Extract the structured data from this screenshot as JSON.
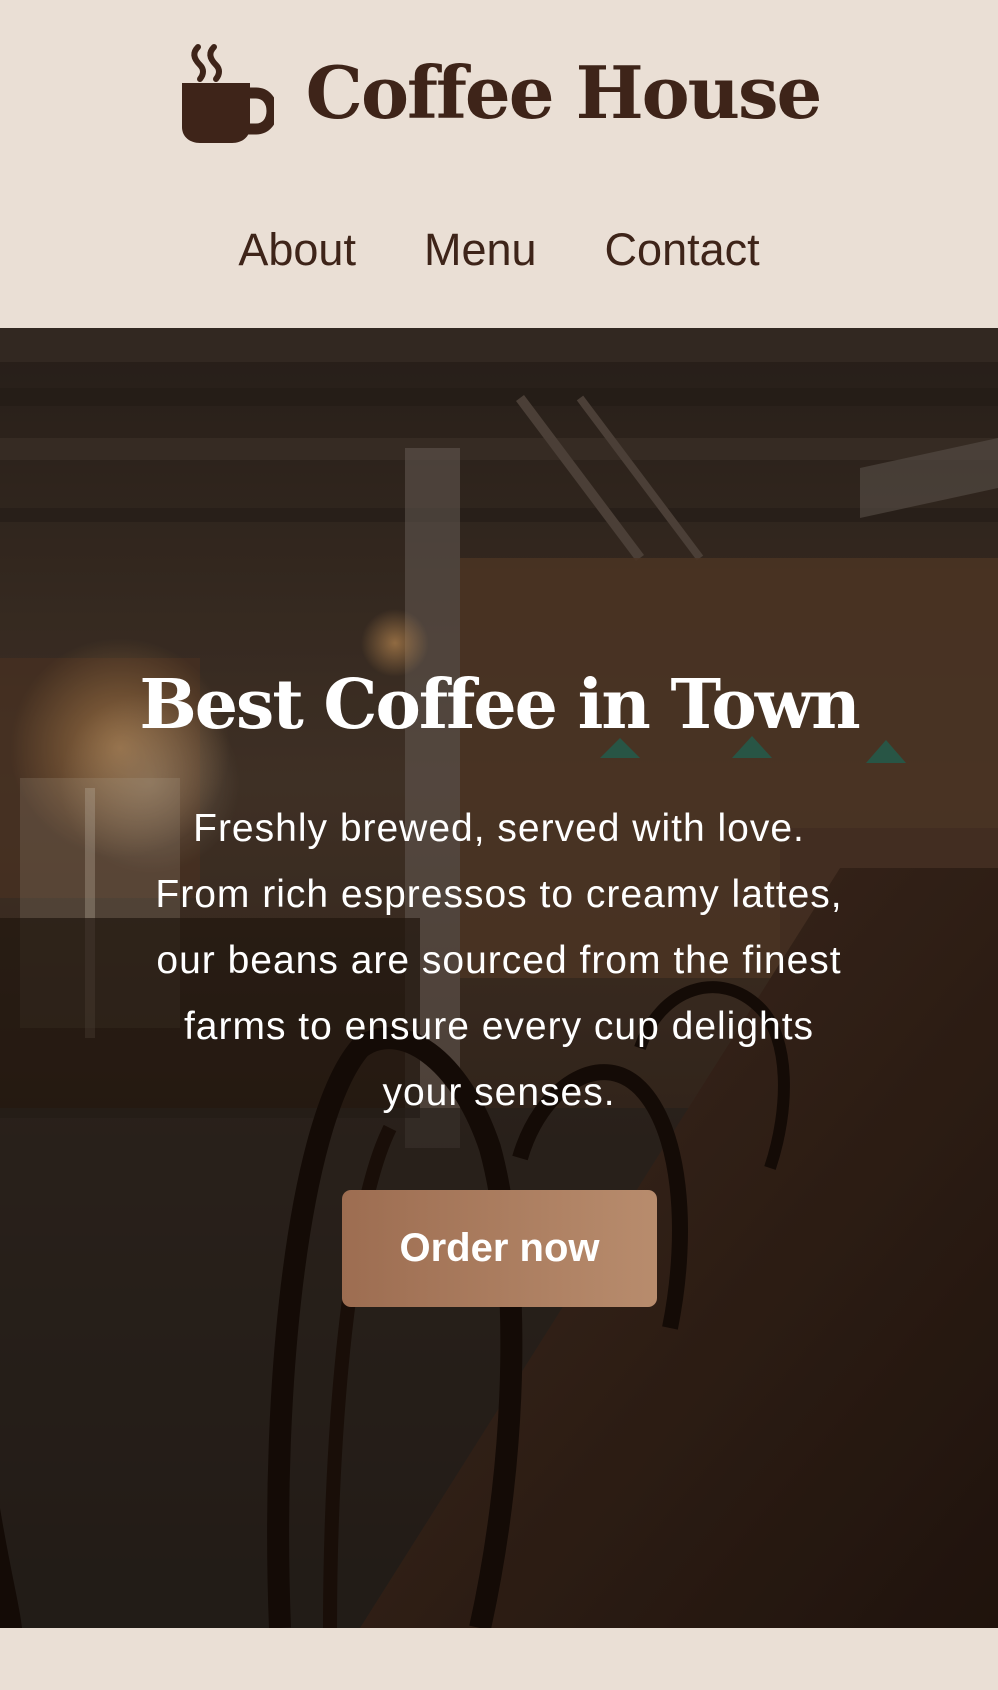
{
  "header": {
    "brand_name": "Coffee House",
    "logo_icon": "coffee-cup-icon",
    "nav": [
      {
        "label": "About"
      },
      {
        "label": "Menu"
      },
      {
        "label": "Contact"
      }
    ]
  },
  "hero": {
    "title": "Best Coffee in Town",
    "text": "Freshly brewed, served with love. From rich espressos to creamy lattes, our beans are sourced from the finest farms to ensure every cup delights your senses.",
    "cta_label": "Order now"
  },
  "colors": {
    "page_background": "#eadfd5",
    "brand_dark": "#3e2419",
    "cta_start": "#9d6d51",
    "cta_end": "#b88c6d",
    "hero_text": "#ffffff"
  }
}
